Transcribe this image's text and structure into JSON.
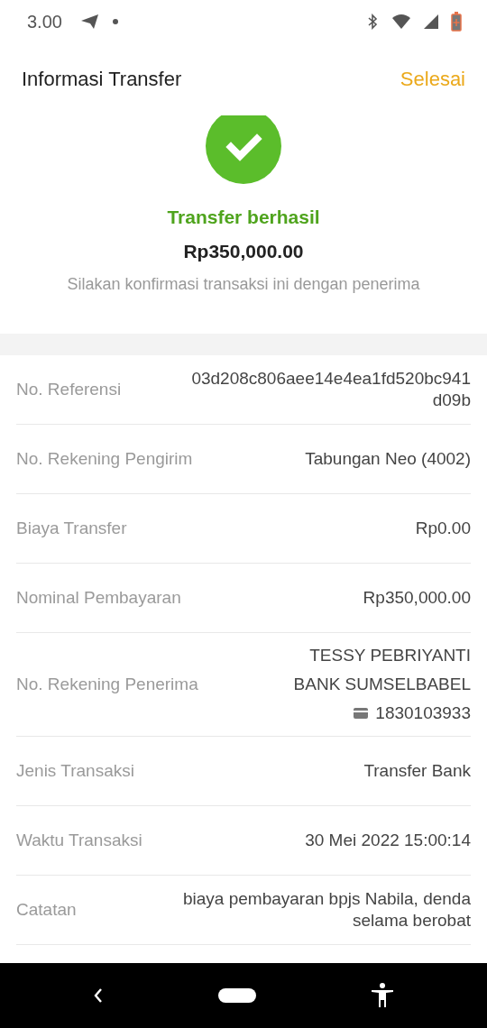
{
  "status_bar": {
    "time": "3.00"
  },
  "header": {
    "title": "Informasi Transfer",
    "action": "Selesai"
  },
  "result": {
    "status": "Transfer berhasil",
    "amount": "Rp350,000.00",
    "note": "Silakan konfirmasi transaksi ini dengan penerima"
  },
  "details": [
    {
      "label": "No. Referensi",
      "value_lines": [
        "03d208c806aee14e4ea1fd520bc941",
        "d09b"
      ]
    },
    {
      "label": "No. Rekening Pengirim",
      "value_lines": [
        "Tabungan Neo (4002)"
      ]
    },
    {
      "label": "Biaya Transfer",
      "value_lines": [
        "Rp0.00"
      ]
    },
    {
      "label": "Nominal Pembayaran",
      "value_lines": [
        "Rp350,000.00"
      ]
    },
    {
      "label": "No. Rekening Penerima",
      "value_lines": [
        "TESSY PEBRIYANTI",
        "BANK SUMSELBABEL"
      ],
      "account": "1830103933"
    },
    {
      "label": "Jenis Transaksi",
      "value_lines": [
        "Transfer Bank"
      ]
    },
    {
      "label": "Waktu Transaksi",
      "value_lines": [
        "30 Mei 2022 15:00:14"
      ]
    },
    {
      "label": "Catatan",
      "value_lines": [
        "biaya pembayaran bpjs Nabila, denda",
        "selama berobat"
      ]
    }
  ]
}
